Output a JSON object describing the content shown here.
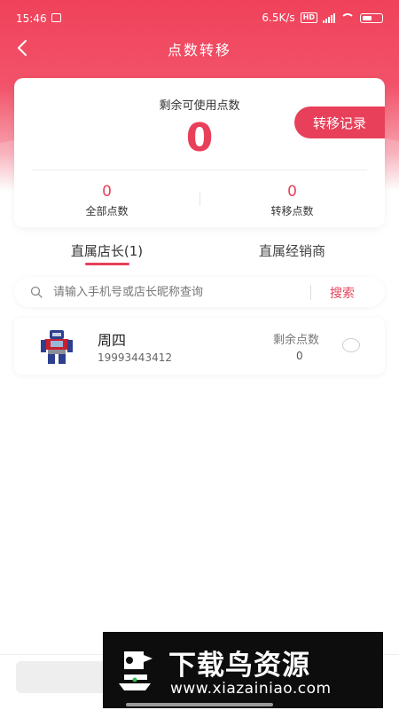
{
  "status_bar": {
    "time": "15:46",
    "network_speed": "6.5K/s",
    "hd_badge": "HD"
  },
  "header": {
    "title": "点数转移"
  },
  "summary": {
    "remaining_label": "剩余可使用点数",
    "remaining_value": "0",
    "transfer_record_button": "转移记录",
    "total_points_value": "0",
    "total_points_label": "全部点数",
    "transfer_points_value": "0",
    "transfer_points_label": "转移点数"
  },
  "tabs": [
    {
      "label": "直属店长(1)",
      "active": true
    },
    {
      "label": "直属经销商",
      "active": false
    }
  ],
  "search": {
    "placeholder": "请输入手机号或店长昵称查询",
    "button_label": "搜索"
  },
  "list": [
    {
      "name": "周四",
      "phone": "19993443412",
      "points_label": "剩余点数",
      "points_value": "0",
      "selected": false
    }
  ],
  "watermark": {
    "title": "下载鸟资源",
    "url": "www.xiazainiao.com"
  },
  "colors": {
    "accent": "#e8405a",
    "header_top": "#f0415a"
  }
}
